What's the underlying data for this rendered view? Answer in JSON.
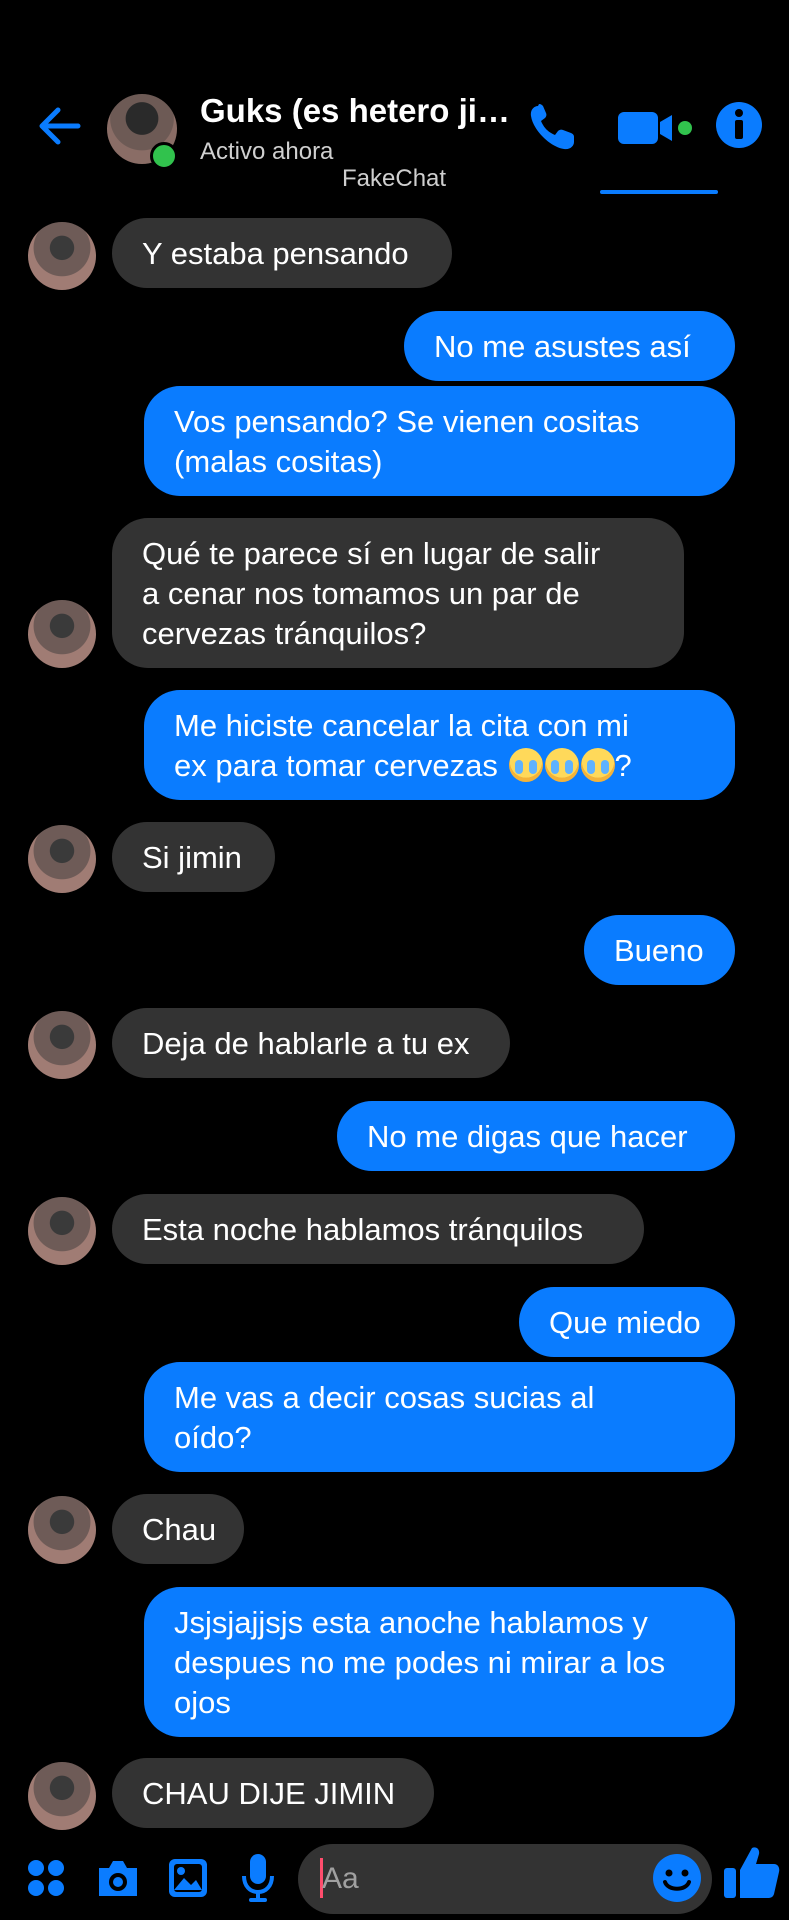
{
  "header": {
    "contact_name": "Guks (es hetero jim…",
    "status": "Activo ahora",
    "watermark": "FakeChat"
  },
  "messages": [
    {
      "side": "received",
      "text": "Y estaba pensando"
    },
    {
      "side": "sent",
      "text": "No me asustes así"
    },
    {
      "side": "sent",
      "lines": [
        "Vos pensando? Se vienen cositas",
        "(malas cositas)"
      ]
    },
    {
      "side": "received",
      "lines": [
        "Qué te parece sí en lugar de salir",
        "a cenar nos tomamos un par de",
        "cervezas tránquilos?"
      ]
    },
    {
      "side": "sent",
      "lines": [
        "Me hiciste cancelar la cita con mi",
        "ex para tomar cervezas"
      ],
      "trailing": "?",
      "emoji": "loudly-crying-face x3"
    },
    {
      "side": "received",
      "text": "Si jimin"
    },
    {
      "side": "sent",
      "text": "Bueno"
    },
    {
      "side": "received",
      "text": "Deja de hablarle a tu ex"
    },
    {
      "side": "sent",
      "text": "No me digas que hacer"
    },
    {
      "side": "received",
      "text": "Esta noche hablamos tránquilos"
    },
    {
      "side": "sent",
      "text": "Que miedo"
    },
    {
      "side": "sent",
      "lines": [
        "Me vas a decir cosas sucias al",
        "oído?"
      ]
    },
    {
      "side": "received",
      "text": "Chau"
    },
    {
      "side": "sent",
      "lines": [
        "Jsjsjajjsjs esta anoche hablamos y",
        "despues no me podes ni mirar a los",
        "ojos"
      ]
    },
    {
      "side": "received",
      "text": "CHAU DIJE JIMIN"
    }
  ],
  "composer": {
    "placeholder": "Aa"
  },
  "colors": {
    "accent": "#0a7cff",
    "received_bubble": "#333333",
    "online": "#31c24d"
  }
}
